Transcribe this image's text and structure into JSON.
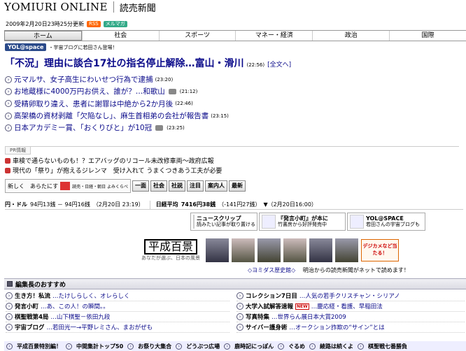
{
  "header": {
    "logo_en": "YOMIURI ONLINE",
    "logo_jp": "読売新聞",
    "updated": "2009年2月20日23時25分更新",
    "rss": "RSS",
    "mailmag": "メルマガ"
  },
  "nav": [
    "ホーム",
    "社会",
    "スポーツ",
    "マネー・経済",
    "政治",
    "国際"
  ],
  "yol": {
    "badge": "YOL@space",
    "text": "・宇宙ブログに若田さん登場！"
  },
  "headline": {
    "text": "「不況」理由に談合17社の指名停止解除…富山・滑川",
    "time": "(22:56)",
    "full": "[全文へ]"
  },
  "news": [
    {
      "text": "元マルサ、女子高生にわいせつ行為で逮捕",
      "time": "(23:20)",
      "cam": false
    },
    {
      "text": "お地蔵様に4000万円お供え、誰が？…和歌山",
      "time": "(21:12)",
      "cam": true
    },
    {
      "text": "受精卵取り違え、患者に謝罪は中絶から2か月後",
      "time": "(22:46)",
      "cam": false
    },
    {
      "text": "高架橋の資材剥離「欠陥なし」、麻生首相弟の会社が報告書",
      "time": "(23:15)",
      "cam": false
    },
    {
      "text": "日本アカデミー賞、「おくりびと」が10冠",
      "time": "(23:25)",
      "cam": true
    }
  ],
  "pr": {
    "label": "PR情報",
    "items": [
      "車検で通らないものも！？エアバッグのリコール未改修車両〜政府広報",
      "現代の「祭り」が抱えるジレンマ　受け入れて うまくつきあう工夫が必要"
    ]
  },
  "toolbar": {
    "new_label": "新しく　あらたにす",
    "new_sub": "読売・日経・朝日 よみくらべ",
    "buttons": [
      "一面",
      "社会",
      "社説",
      "注目",
      "案内人",
      "最新"
    ]
  },
  "market": {
    "yen_label": "円・ドル",
    "yen_value": "94円13銭 － 94円16銭",
    "yen_time": "（2月20日 23:19）",
    "nikkei_label": "日経平均",
    "nikkei_value": "7416円38銭",
    "nikkei_change": "（-141円27銭）",
    "nikkei_time": "▼（2月20日16:00）"
  },
  "services": [
    {
      "title": "ニュースクリップ",
      "sub": "読みたい記事が取り置ける"
    },
    {
      "title": "『発言小町』が本に",
      "sub": "竹書房から好評発売中"
    },
    {
      "title": "YOL@SPACE",
      "sub": "若田さんの宇宙ブログも"
    }
  ],
  "heisei": {
    "logo": "平成百景",
    "tagline": "あなたが選ぶ、日本の風景",
    "digi": "デジカメなど当たる！"
  },
  "history": {
    "link": "◇ヨミダス歴史館◇",
    "text": "明治からの読売新聞がネットで読めます！"
  },
  "editor": {
    "title": "編集長のおすすめ"
  },
  "left_col": [
    {
      "bold": "生き方！私流",
      "text": "…たけしらしく、オレらしく"
    },
    {
      "bold": "発言小町",
      "text": "…あ、この人！の瞬間。。"
    },
    {
      "bold": "棋聖戦第4局",
      "text": "…山下棋聖－依田九段"
    },
    {
      "bold": "宇宙ブログ",
      "text": "…若田光一→平野レミさん、まおがぜも"
    }
  ],
  "right_col": [
    {
      "bold": "コレクション7日目",
      "text": "…人気の若手クリスチャン・シリアノ",
      "new": false
    },
    {
      "bold": "大学入試解答速報",
      "text": "…慶応経・看護、早稲田法",
      "new": true
    },
    {
      "bold": "写真特集",
      "text": "…世界らん展日本大賞2009",
      "new": false
    },
    {
      "bold": "サイバー護身術",
      "text": "…オークション詐欺の“サイン”とは",
      "new": false
    }
  ],
  "bottom": [
    "平成百景特別編！",
    "中間集計トップ50",
    "お祭り大集合",
    "どうぶつ広場",
    "鹿時記にっぽん",
    "ぐるめ",
    "綾路は続くよ",
    "棋聖戦七番勝負"
  ],
  "colors": {
    "link": "#0a0a8a",
    "rss": "#f60",
    "mailmag": "#3a8",
    "yol_badge": "#2a4a8a"
  }
}
